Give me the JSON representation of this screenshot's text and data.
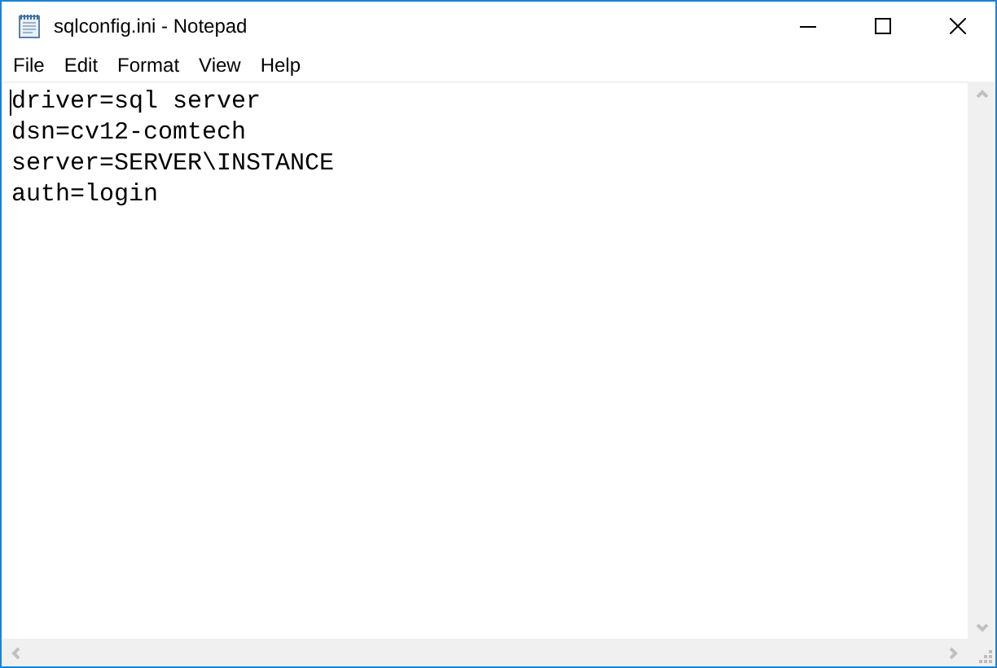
{
  "window": {
    "title": "sqlconfig.ini - Notepad"
  },
  "menu": [
    {
      "label": "File"
    },
    {
      "label": "Edit"
    },
    {
      "label": "Format"
    },
    {
      "label": "View"
    },
    {
      "label": "Help"
    }
  ],
  "editor": {
    "lines": [
      "driver=sql server",
      "dsn=cv12-comtech",
      "server=SERVER\\INSTANCE",
      "auth=login"
    ]
  }
}
